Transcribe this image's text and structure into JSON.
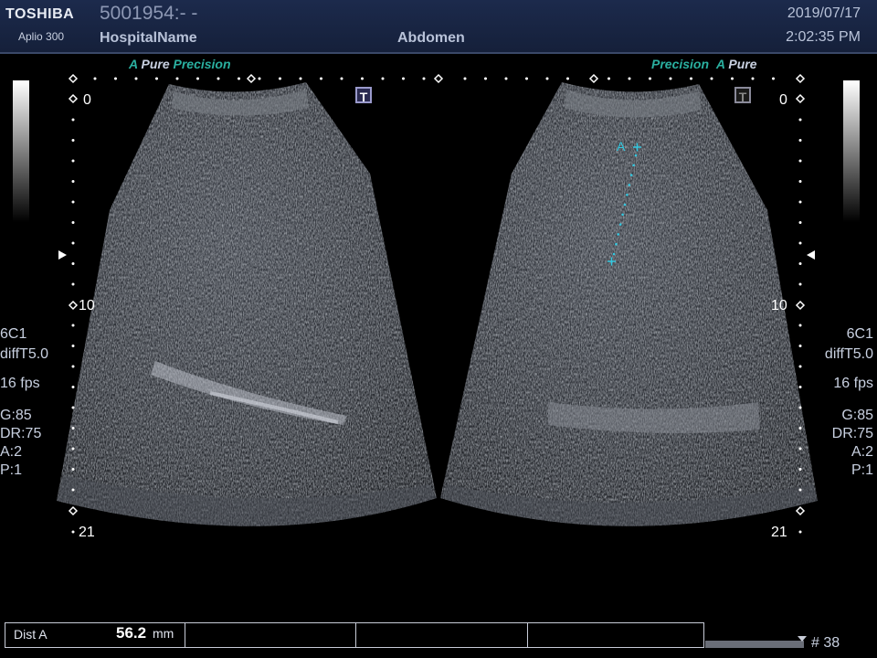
{
  "header": {
    "brand": "TOSHIBA",
    "model": "Aplio 300",
    "patient_id": "5001954:- -",
    "hospital": "HospitalName",
    "exam": "Abdomen",
    "date": "2019/07/17",
    "time": "2:02:35 PM"
  },
  "left_panel": {
    "mode_a": "A",
    "mode_pure": "Pure",
    "mode_precision": "Precision",
    "depth_top": "0",
    "depth_mid": "10",
    "depth_bottom": "21",
    "t_badge": "T"
  },
  "right_panel": {
    "mode_precision": "Precision",
    "mode_a": "A",
    "mode_pure": "Pure",
    "depth_top": "0",
    "depth_mid": "10",
    "depth_bottom": "21",
    "t_badge": "T"
  },
  "params": {
    "probe": "6C1",
    "harmonic": "diffT5.0",
    "fps": "16 fps",
    "gain": "G:85",
    "dynamic_range": "DR:75",
    "acoustic": "A:2",
    "persistence": "P:1"
  },
  "caliper_label": "A",
  "measurement": {
    "label": "Dist A",
    "value": "56.2",
    "unit": "mm"
  },
  "frame_number": "# 38",
  "colors": {
    "header_bg": "#1c2a4c",
    "accent_teal": "#2ab0a0",
    "caliper_cyan": "#33c8e0"
  }
}
